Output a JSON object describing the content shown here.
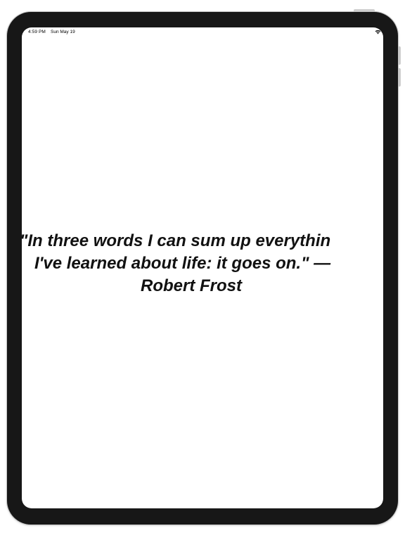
{
  "status_bar": {
    "time": "4:59 PM",
    "date": "Sun May 19",
    "icons": [
      "wifi-icon"
    ]
  },
  "quote": {
    "line1": "\"In three words I can sum up everythin",
    "line2": "I've learned about life: it goes on.\" —",
    "line3": "Robert Frost"
  },
  "colors": {
    "bezel": "#171717",
    "screen": "#ffffff",
    "text": "#111111"
  }
}
